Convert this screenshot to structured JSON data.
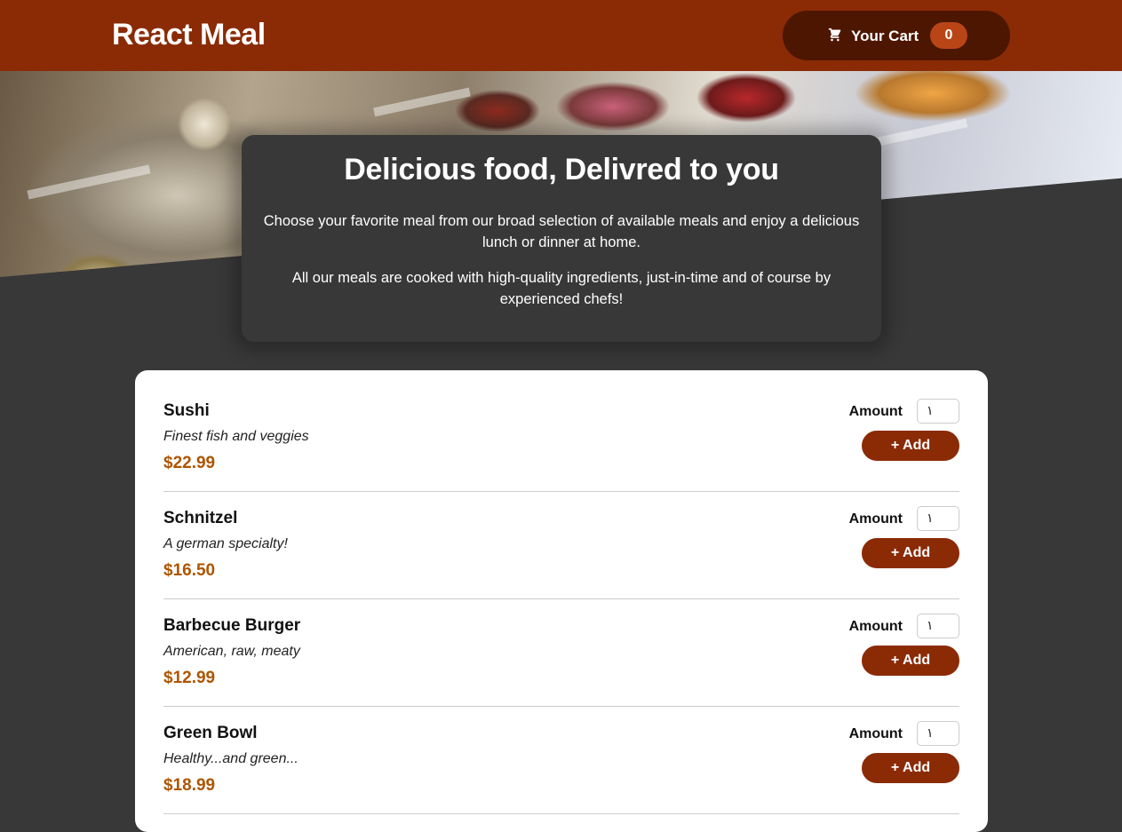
{
  "header": {
    "brand": "React Meal",
    "cart": {
      "label": "Your Cart",
      "count": "0",
      "icon": "cart-icon"
    }
  },
  "summary": {
    "title": "Delicious food, Delivred to you",
    "paragraph1": "Choose your favorite meal from our broad selection of available meals and enjoy a delicious lunch or dinner at home.",
    "paragraph2": "All our meals are cooked with high-quality ingredients, just-in-time and of course by experienced chefs!"
  },
  "meals": [
    {
      "name": "Sushi",
      "description": "Finest fish and veggies",
      "price": "$22.99",
      "amount_label": "Amount",
      "amount_value": "١",
      "add_label": "+ Add"
    },
    {
      "name": "Schnitzel",
      "description": "A german specialty!",
      "price": "$16.50",
      "amount_label": "Amount",
      "amount_value": "١",
      "add_label": "+ Add"
    },
    {
      "name": "Barbecue Burger",
      "description": "American, raw, meaty",
      "price": "$12.99",
      "amount_label": "Amount",
      "amount_value": "١",
      "add_label": "+ Add"
    },
    {
      "name": "Green Bowl",
      "description": "Healthy...and green...",
      "price": "$18.99",
      "amount_label": "Amount",
      "amount_value": "١",
      "add_label": "+ Add"
    }
  ],
  "colors": {
    "header": "#8a2b06",
    "cart_button": "#4d1601",
    "cart_badge": "#b94517",
    "price": "#ad5502",
    "background": "#383838"
  }
}
